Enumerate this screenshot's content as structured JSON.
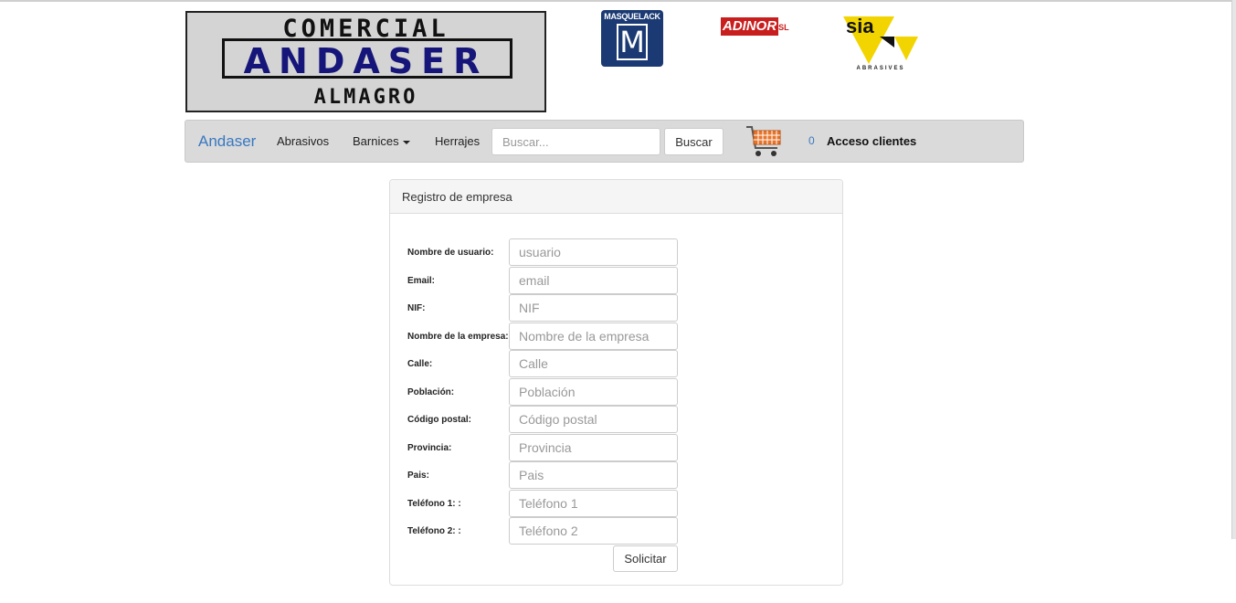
{
  "logos": {
    "main": {
      "line1": "COMERCIAL",
      "line2": "ANDASER",
      "line3": "ALMAGRO"
    },
    "masquelack": {
      "label": "MASQUELACK",
      "letter": "M"
    },
    "adinor": {
      "label": "ADINOR",
      "suffix": "SL"
    },
    "sia": {
      "label": "sia",
      "caption": "ABRASIVES"
    }
  },
  "navbar": {
    "brand": "Andaser",
    "items": [
      {
        "label": "Abrasivos"
      },
      {
        "label": "Barnices"
      },
      {
        "label": "Herrajes"
      }
    ],
    "search": {
      "placeholder": "Buscar...",
      "value": ""
    },
    "search_button": "Buscar",
    "cart_icon": "shopping-cart-icon",
    "cart_count": "0",
    "access": "Acceso clientes"
  },
  "panel": {
    "title": "Registro de empresa",
    "fields": [
      {
        "label": "Nombre de usuario:",
        "placeholder": "usuario"
      },
      {
        "label": "Email:",
        "placeholder": "email"
      },
      {
        "label": "NIF:",
        "placeholder": "NIF"
      },
      {
        "label": "Nombre de la empresa:",
        "placeholder": "Nombre de la empresa"
      },
      {
        "label": "Calle:",
        "placeholder": "Calle"
      },
      {
        "label": "Población:",
        "placeholder": "Población"
      },
      {
        "label": "Código postal:",
        "placeholder": "Código postal"
      },
      {
        "label": "Provincia:",
        "placeholder": "Provincia"
      },
      {
        "label": "Pais:",
        "placeholder": "Pais"
      },
      {
        "label": "Teléfono 1: :",
        "placeholder": "Teléfono 1"
      },
      {
        "label": "Teléfono 2: :",
        "placeholder": "Teléfono 2"
      }
    ],
    "submit": "Solicitar"
  },
  "colors": {
    "brand": "#3a78c3",
    "navbar_bg": "#d9dad9",
    "logo_blue": "#16167a",
    "adinor_red": "#c81e1e",
    "sia_yellow": "#f2d500"
  }
}
